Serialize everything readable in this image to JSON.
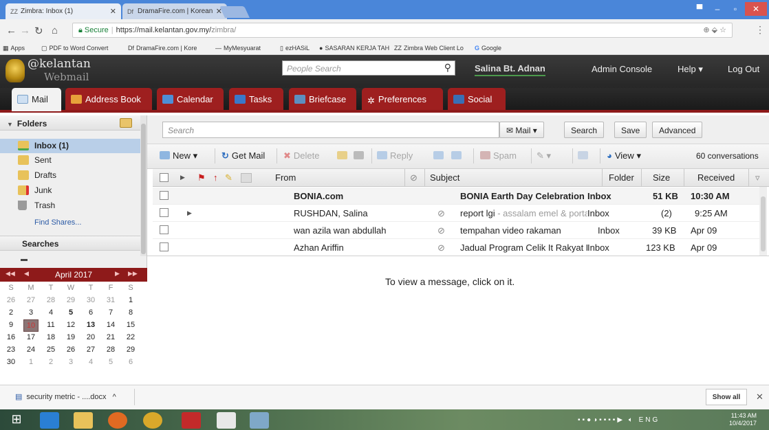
{
  "browser": {
    "tabs": [
      {
        "label": "Zimbra: Inbox (1)",
        "favicon": "ZZ"
      },
      {
        "label": "DramaFire.com | Korean",
        "favicon": "Df"
      }
    ],
    "url_host": "https://mail.kelantan.gov.my/",
    "url_path": "zimbra/",
    "secure_label": "Secure",
    "bookmarks": [
      "Apps",
      "PDF to Word Convert",
      "DramaFire.com | Kore",
      "MyMesyuarat",
      "ezHASiL",
      "SASARAN KERJA TAH",
      "Zimbra Web Client Lo",
      "Google"
    ]
  },
  "header": {
    "logo_line1": "@kelantan",
    "logo_line2": "Webmail",
    "people_search_placeholder": "People Search",
    "user_name": "Salina Bt. Adnan",
    "admin_console": "Admin Console",
    "help": "Help",
    "logout": "Log Out"
  },
  "app_tabs": [
    "Mail",
    "Address Book",
    "Calendar",
    "Tasks",
    "Briefcase",
    "Preferences",
    "Social"
  ],
  "sidebar": {
    "folders_title": "Folders",
    "folders": [
      {
        "label": "Inbox (1)"
      },
      {
        "label": "Sent"
      },
      {
        "label": "Drafts"
      },
      {
        "label": "Junk"
      },
      {
        "label": "Trash"
      }
    ],
    "find_shares": "Find Shares...",
    "searches_title": "Searches"
  },
  "calendar": {
    "month": "April 2017",
    "weekdays": [
      "S",
      "M",
      "T",
      "W",
      "T",
      "F",
      "S"
    ],
    "weeks": [
      [
        "26",
        "27",
        "28",
        "29",
        "30",
        "31",
        "1"
      ],
      [
        "2",
        "3",
        "4",
        "5",
        "6",
        "7",
        "8"
      ],
      [
        "9",
        "10",
        "11",
        "12",
        "13",
        "14",
        "15"
      ],
      [
        "16",
        "17",
        "18",
        "19",
        "20",
        "21",
        "22"
      ],
      [
        "23",
        "24",
        "25",
        "26",
        "27",
        "28",
        "29"
      ],
      [
        "30",
        "1",
        "2",
        "3",
        "4",
        "5",
        "6"
      ]
    ]
  },
  "search": {
    "placeholder": "Search",
    "scope": "Mail",
    "search_btn": "Search",
    "save_btn": "Save",
    "advanced_btn": "Advanced"
  },
  "toolbar": {
    "new": "New",
    "get_mail": "Get Mail",
    "delete": "Delete",
    "reply": "Reply",
    "spam": "Spam",
    "view": "View",
    "count": "60 conversations"
  },
  "list": {
    "headers": {
      "from": "From",
      "subject": "Subject",
      "folder": "Folder",
      "size": "Size",
      "received": "Received"
    },
    "rows": [
      {
        "from": "BONIA.com",
        "subject": "BONIA Earth Day Celebration",
        "fragment": " - ",
        "folder": "Inbox",
        "size": "51 KB",
        "received": "10:30 AM"
      },
      {
        "from": "RUSHDAN, Salina",
        "subject": "report lgi",
        "fragment": " - assalam emel & porta",
        "folder": "Inbox",
        "size": "(2)",
        "received": "9:25 AM"
      },
      {
        "from": "wan azila wan abdullah",
        "subject": "tempahan video rakaman",
        "fragment": "",
        "folder": "Inbox",
        "size": "39 KB",
        "received": "Apr 09"
      },
      {
        "from": "Azhan Ariffin",
        "subject": "Jadual Program Celik It Rakyat K",
        "fragment": "",
        "folder": "Inbox",
        "size": "123 KB",
        "received": "Apr 09"
      }
    ]
  },
  "reading_pane": {
    "message": "To view a message, click on it."
  },
  "downloads": {
    "file": "security metric - ....docx",
    "show_all": "Show all"
  },
  "taskbar": {
    "lang": "ENG",
    "time": "11:43 AM",
    "date": "10/4/2017"
  }
}
